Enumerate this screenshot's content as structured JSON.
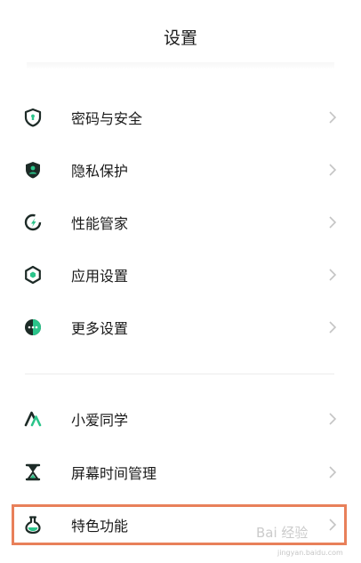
{
  "header": {
    "title": "设置"
  },
  "menu": {
    "items": [
      {
        "label": "密码与安全",
        "icon": "shield-lock-icon"
      },
      {
        "label": "隐私保护",
        "icon": "privacy-shield-icon"
      },
      {
        "label": "性能管家",
        "icon": "performance-icon"
      },
      {
        "label": "应用设置",
        "icon": "app-settings-icon"
      },
      {
        "label": "更多设置",
        "icon": "more-settings-icon"
      },
      {
        "label": "小爱同学",
        "icon": "xiaoai-icon"
      },
      {
        "label": "屏幕时间管理",
        "icon": "hourglass-icon"
      },
      {
        "label": "特色功能",
        "icon": "flask-icon"
      }
    ]
  },
  "watermark": {
    "text": "Bai 经验",
    "sub": "jingyan.baidu.com"
  },
  "colors": {
    "icon": "#1d2b27",
    "accent": "#2bc48a",
    "highlight": "#e8805a",
    "chevron": "#c4c4c4"
  }
}
